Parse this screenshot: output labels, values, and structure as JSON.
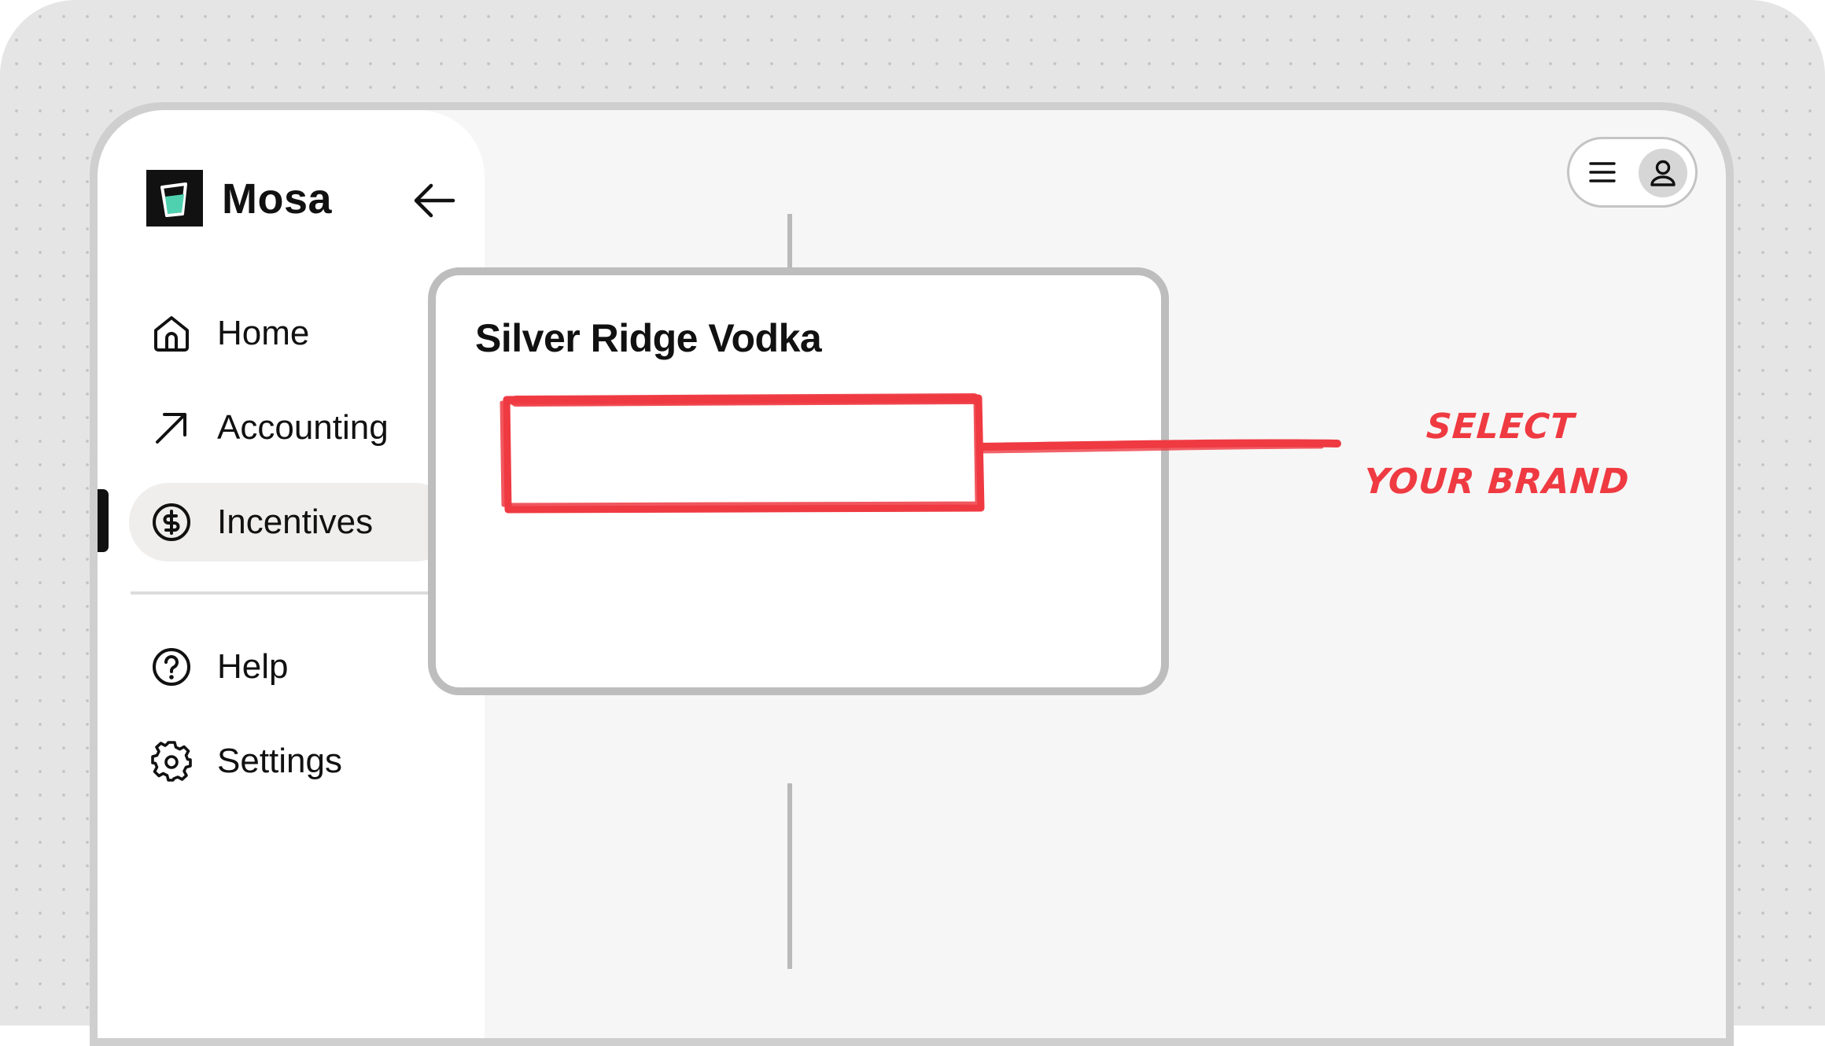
{
  "app": {
    "name": "Mosa"
  },
  "sidebar": {
    "items": [
      {
        "label": "Home",
        "icon": "home-icon"
      },
      {
        "label": "Accounting",
        "icon": "arrow-up-right-icon"
      },
      {
        "label": "Incentives",
        "icon": "dollar-circle-icon",
        "active": true
      },
      {
        "label": "Help",
        "icon": "help-circle-icon"
      },
      {
        "label": "Settings",
        "icon": "gear-icon"
      }
    ]
  },
  "brand_list": {
    "options": [
      {
        "label": "Silver Ridge Vodka"
      }
    ]
  },
  "annotation": {
    "line1": "SELECT",
    "line2": "YOUR BRAND"
  },
  "colors": {
    "accent": "#ef3a42",
    "logo_green": "#4fd1b0",
    "active_bg": "#efeeed"
  }
}
